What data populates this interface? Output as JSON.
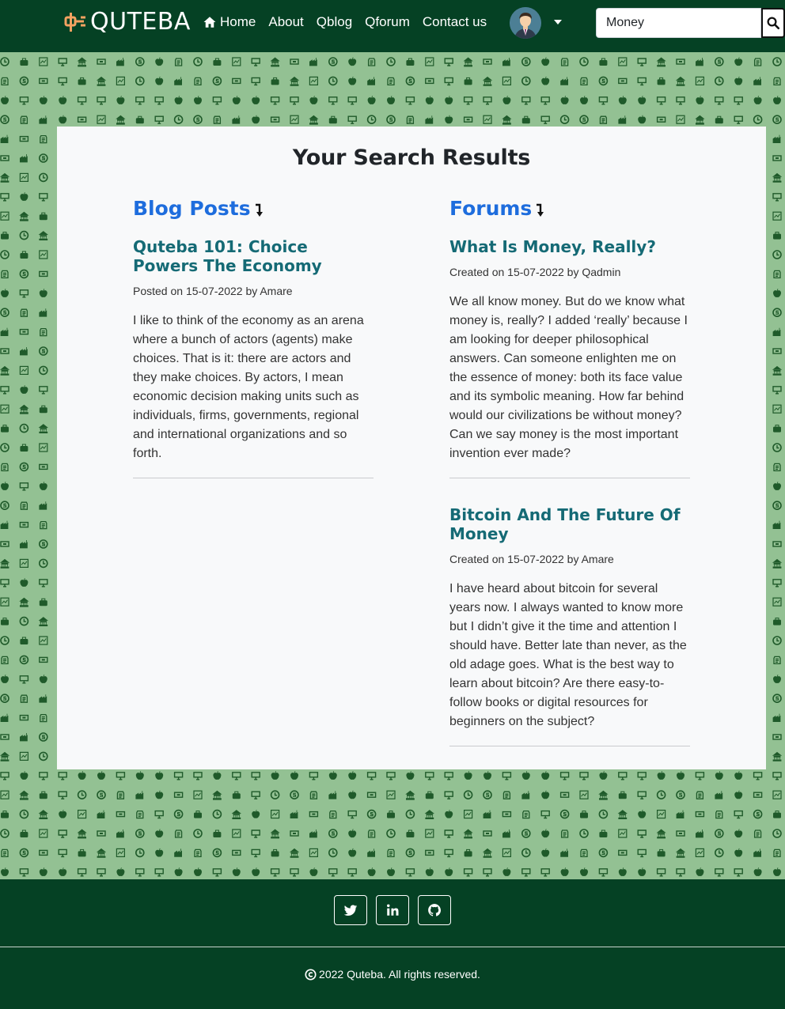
{
  "navbar": {
    "brand": "QUTEBA",
    "brand_icon": "quteba-logo-icon",
    "links": [
      {
        "label": "Home",
        "icon": "home-icon"
      },
      {
        "label": "About"
      },
      {
        "label": "Qblog"
      },
      {
        "label": "Qforum"
      },
      {
        "label": "Contact us"
      }
    ],
    "search": {
      "value": "Money"
    }
  },
  "colors": {
    "navbar_bg": "#054124",
    "pattern_bg": "#93c193",
    "pattern_icon": "#1f5a2a",
    "card_bg": "#f8f9fa",
    "heading_blue": "#1e6ddd",
    "post_title": "#156a75",
    "brand_accent": "#f4a261"
  },
  "main": {
    "title": "Your Search Results",
    "blog": {
      "heading": "Blog Posts",
      "posts": [
        {
          "title": "Quteba 101: Choice Powers The Economy",
          "meta": "Posted on 15-07-2022 by Amare",
          "body": "I like to think of the economy as an arena where a bunch of actors (agents) make choices. That is it: there are actors and they make choices. By actors, I mean economic decision making units such as individuals, firms, governments, regional and international organizations and so forth."
        }
      ]
    },
    "forums": {
      "heading": "Forums",
      "posts": [
        {
          "title": "What Is Money, Really?",
          "meta": "Created on 15-07-2022 by Qadmin",
          "body": "We all know money. But do we know what money is, really? I added ‘really’ because I am looking for deeper philosophical answers. Can someone enlighten me on the essence of money: both its face value and its symbolic meaning. How far behind would our civilizations be without money? Can we say money is the most important invention ever made?"
        },
        {
          "title": "Bitcoin And The Future Of Money",
          "meta": "Created on 15-07-2022 by Amare",
          "body": "I have heard about bitcoin for several years now. I always wanted to know more but I didn’t give it the time and attention I should have. Better late than never, as the old adage goes. What is the best way to learn about bitcoin? Are there easy-to-follow books or digital resources for beginners on the subject?"
        }
      ]
    }
  },
  "footer": {
    "social": [
      {
        "name": "twitter-icon"
      },
      {
        "name": "linkedin-icon"
      },
      {
        "name": "github-icon"
      }
    ],
    "copyright": "2022 Quteba. All rights reserved."
  }
}
